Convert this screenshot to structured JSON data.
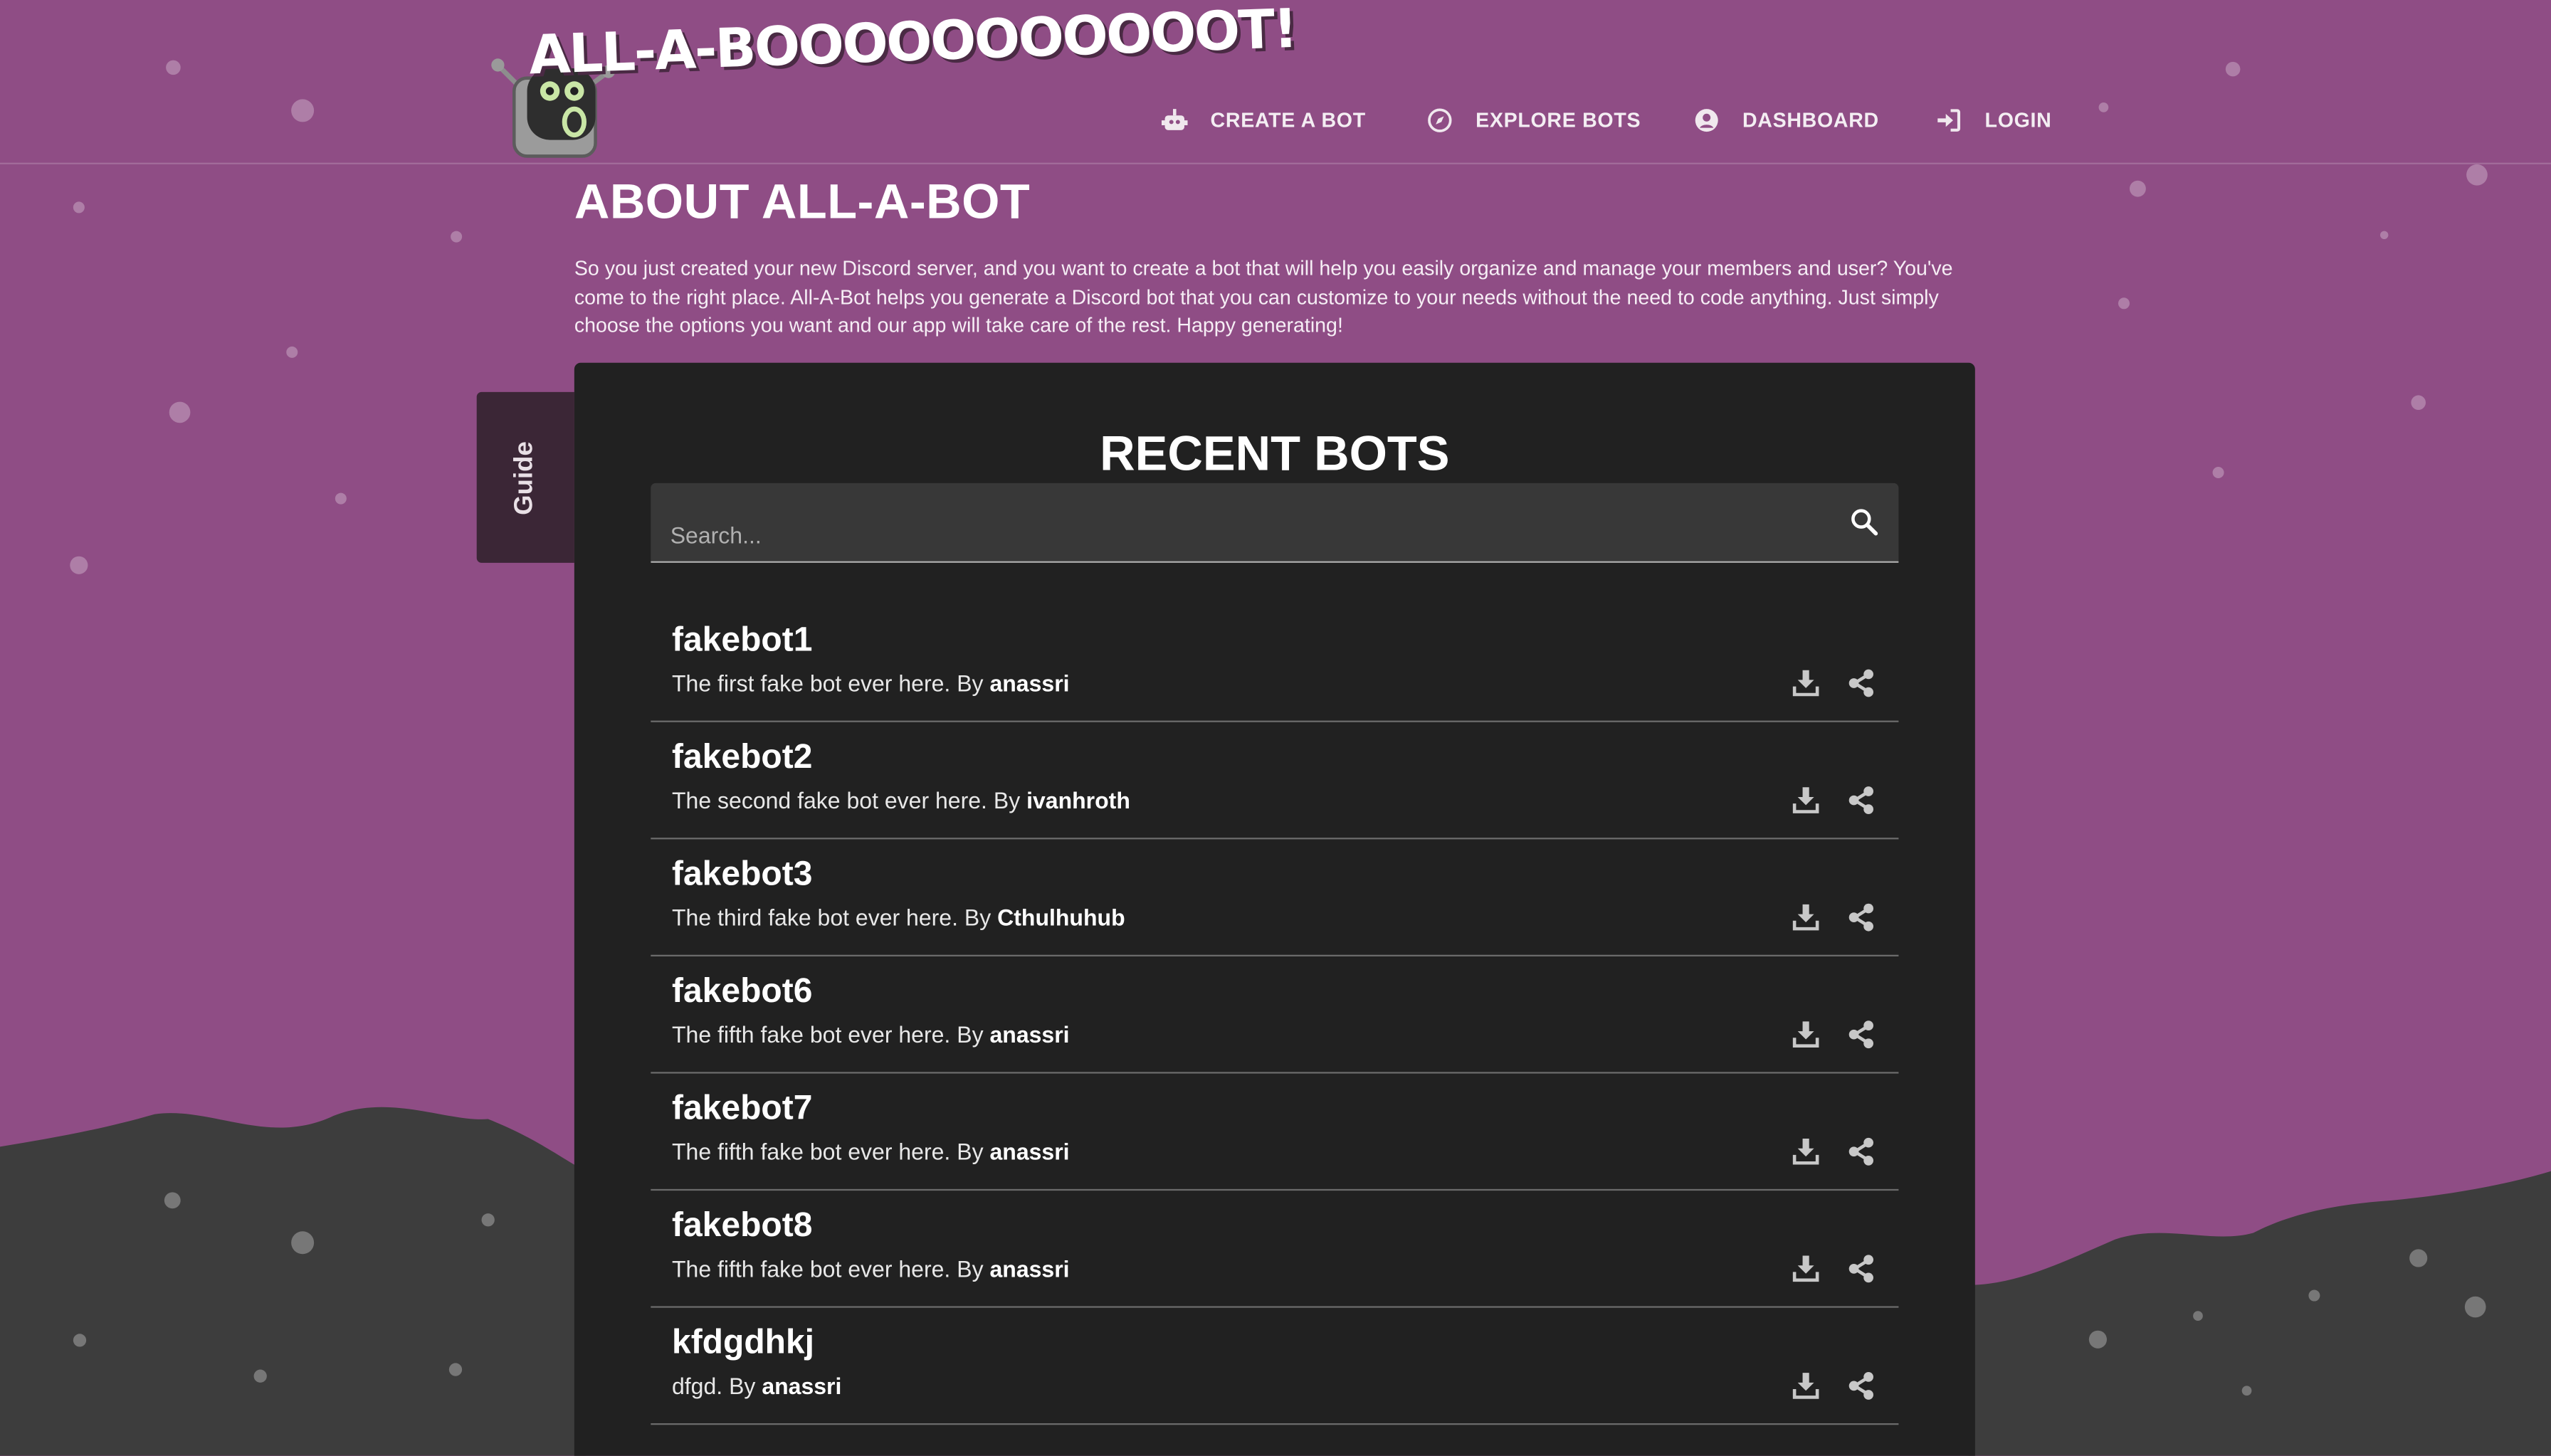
{
  "brand": {
    "logo_text": "ALL-A-BOOOOOOOOOOOT!"
  },
  "nav": [
    {
      "label": "CREATE A BOT",
      "icon": "robot-icon"
    },
    {
      "label": "EXPLORE BOTS",
      "icon": "compass-icon"
    },
    {
      "label": "DASHBOARD",
      "icon": "user-circle-icon"
    },
    {
      "label": "LOGIN",
      "icon": "login-icon"
    }
  ],
  "about": {
    "title": "ABOUT ALL-A-BOT",
    "text": "So you just created your new Discord server, and you want to create a bot that will help you easily organize and manage your members and user? You've come to the right place. All-A-Bot helps you generate a Discord bot that you can customize to your needs without the need to code anything. Just simply choose the options you want and our app will take care of the rest. Happy generating!"
  },
  "guide_tab": {
    "label": "Guide"
  },
  "recent": {
    "title": "RECENT BOTS",
    "search_placeholder": "Search...",
    "by_label": "By",
    "bots": [
      {
        "name": "fakebot1",
        "description": "The first fake bot ever here.",
        "author": "anassri"
      },
      {
        "name": "fakebot2",
        "description": "The second fake bot ever here.",
        "author": "ivanhroth"
      },
      {
        "name": "fakebot3",
        "description": "The third fake bot ever here.",
        "author": "Cthulhuhub"
      },
      {
        "name": "fakebot6",
        "description": "The fifth fake bot ever here.",
        "author": "anassri"
      },
      {
        "name": "fakebot7",
        "description": "The fifth fake bot ever here.",
        "author": "anassri"
      },
      {
        "name": "fakebot8",
        "description": "The fifth fake bot ever here.",
        "author": "anassri"
      },
      {
        "name": "kfdgdhkj",
        "description": "dfgd.",
        "author": "anassri"
      }
    ]
  },
  "colors": {
    "background_purple": "#8f4d85",
    "hills_dark": "#3d3d3d",
    "panel": "#212121",
    "search_field": "#383838",
    "guide_tab": "#3b2636"
  }
}
